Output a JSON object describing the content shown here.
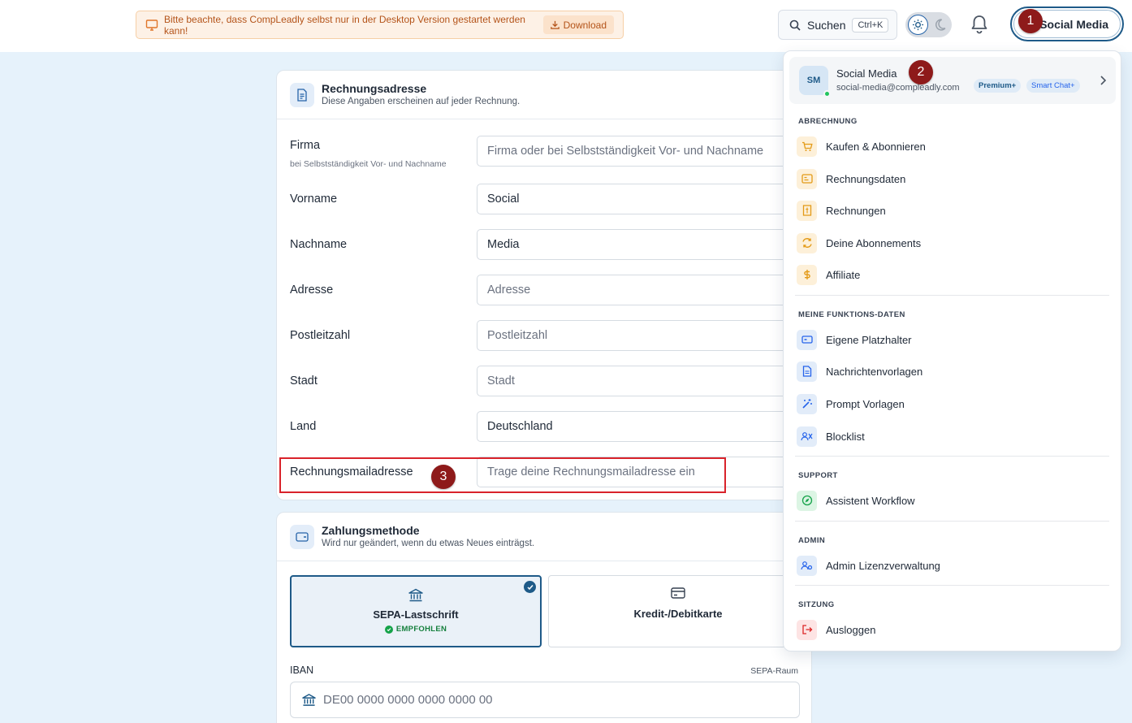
{
  "topbar": {
    "notice_text": "Bitte beachte, dass CompLeadly selbst nur in der Desktop Version gestartet werden kann!",
    "download_label": "Download",
    "search_label": "Suchen",
    "search_shortcut": "Ctrl+K",
    "user_label": "Social Media"
  },
  "markers": [
    "1",
    "2",
    "3"
  ],
  "billing": {
    "title": "Rechnungsadresse",
    "subtitle": "Diese Angaben erscheinen auf jeder Rechnung.",
    "fields": [
      {
        "label": "Firma",
        "hint": "bei Selbstständigkeit Vor- und Nachname",
        "value": "Firma oder bei Selbstständigkeit Vor- und Nachname",
        "is_placeholder": true
      },
      {
        "label": "Vorname",
        "value": "Social",
        "is_placeholder": false
      },
      {
        "label": "Nachname",
        "value": "Media",
        "is_placeholder": false
      },
      {
        "label": "Adresse",
        "value": "Adresse",
        "is_placeholder": true
      },
      {
        "label": "Postleitzahl",
        "value": "Postleitzahl",
        "is_placeholder": true
      },
      {
        "label": "Stadt",
        "value": "Stadt",
        "is_placeholder": true
      },
      {
        "label": "Land",
        "value": "Deutschland",
        "is_placeholder": false
      },
      {
        "label": "Rechnungsmailadresse",
        "value": "Trage deine Rechnungsmailadresse ein",
        "is_placeholder": true
      }
    ]
  },
  "payment": {
    "title": "Zahlungsmethode",
    "subtitle": "Wird nur geändert, wenn du etwas Neues einträgst.",
    "option_sepa": "SEPA-Lastschrift",
    "option_sepa_badge": "EMPFOHLEN",
    "option_card": "Kredit-/Debitkarte",
    "iban_label": "IBAN",
    "iban_note": "SEPA-Raum",
    "iban_placeholder": "DE00 0000 0000 0000 0000 00"
  },
  "menu": {
    "profile": {
      "initials": "SM",
      "name": "Social Media",
      "email": "social-media@compleadly.com",
      "badge_1": "Premium+",
      "badge_2": "Smart Chat+"
    },
    "sections": {
      "billing": "ABRECHNUNG",
      "functions": "MEINE FUNKTIONS-DATEN",
      "support": "SUPPORT",
      "admin": "ADMIN",
      "session": "SITZUNG"
    },
    "items": {
      "buy": "Kaufen & Abonnieren",
      "billing_data": "Rechnungsdaten",
      "invoices": "Rechnungen",
      "subscriptions": "Deine Abonnements",
      "affiliate": "Affiliate",
      "placeholders": "Eigene Platzhalter",
      "templates": "Nachrichtenvorlagen",
      "prompts": "Prompt Vorlagen",
      "blocklist": "Blocklist",
      "workflow": "Assistent Workflow",
      "licenses": "Admin Lizenzverwaltung",
      "logout": "Ausloggen"
    }
  }
}
